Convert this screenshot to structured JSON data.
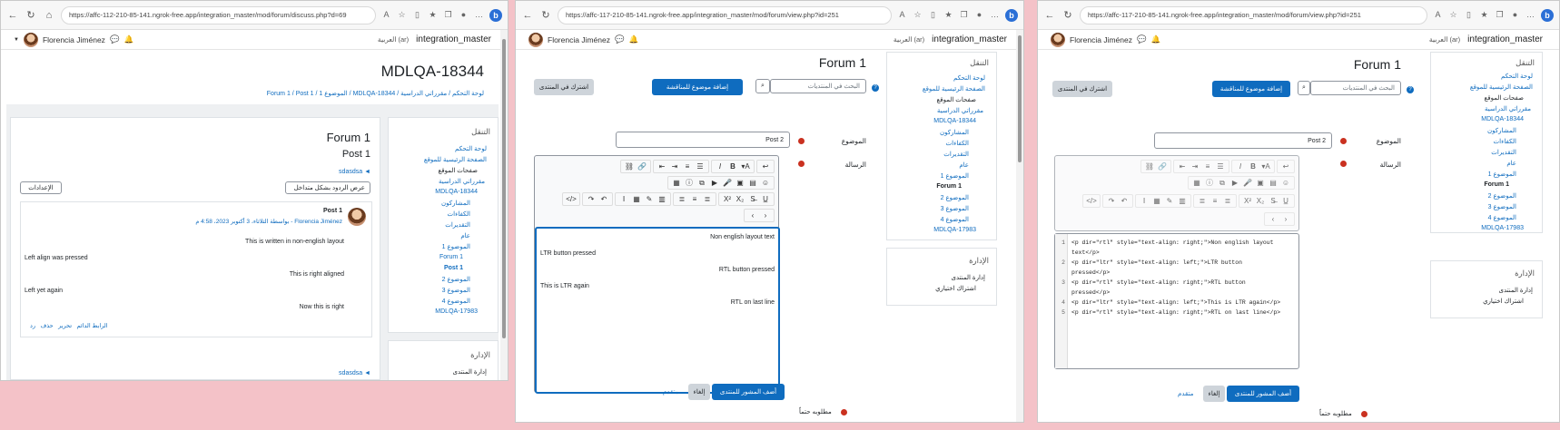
{
  "win1": {
    "url": "https://affc-112-210-85-141.ngrok-free.app/integration_master/mod/forum/discuss.php?d=69",
    "site": "integration_master",
    "lang": "العربية (ar)",
    "user": "Florencia Jiménez",
    "page_title": "MDLQA-18344",
    "breadcrumb": [
      "لوحة التحكم",
      "مقرراتي الدراسية",
      "MDLQA-18344",
      "الموضوع 1",
      "Forum 1",
      "Post 1"
    ],
    "nav_header": "التنقل",
    "nav_items": [
      "لوحة التحكم",
      "الصفحة الرئيسية للموقع",
      "صفحات الموقع",
      "مقرراتي الدراسية",
      "MDLQA-18344",
      "المشاركون",
      "الكفاءات",
      "التقديرات",
      "عام",
      "الموضوع 1",
      "Forum 1",
      "Post 1",
      "الموضوع 2",
      "الموضوع 3",
      "الموضوع 4",
      "MDLQA-17983"
    ],
    "admin_header": "الإدارة",
    "admin_item": "إدارة المنتدى",
    "forum_title": "Forum 1",
    "post_heading": "Post 1",
    "neighbor_link": "sdasdsa ◄",
    "display_mode": "عرض الردود بشكل متداخل",
    "settings": "الإعدادات",
    "post_subject": "Post 1",
    "post_by": "بواسطة الثلاثاء، 3 أكتوبر 2023، 4:58 م - Florencia Jiménez",
    "post_lines": [
      "This is written in non-english layout",
      "Left align was pressed",
      "This is right aligned",
      "Left yet again",
      "Now this is right"
    ],
    "post_actions": [
      "الرابط الدائم",
      "تحرير",
      "حذف",
      "رد"
    ],
    "neighbor_link2": "sdasdsa ◄"
  },
  "win2": {
    "url": "https://affc-117-210-85-141.ngrok-free.app/integration_master/mod/forum/view.php?id=251",
    "site": "integration_master",
    "lang": "العربية (ar)",
    "user": "Florencia Jiménez",
    "forum_title": "Forum 1",
    "search_placeholder": "البحث في المنتديات",
    "add_topic": "إضافة موضوع للمناقشة",
    "subscribe": "اشترك في المنتدى",
    "subject_label": "الموضوع",
    "subject_value": "Post 2",
    "message_label": "الرسالة",
    "editor_lines": [
      "Non english layout text",
      "LTR button pressed",
      "RTL button pressed",
      "This is LTR again",
      "RTL on last line"
    ],
    "post_btn": "أضف المشور للمنتدى",
    "cancel_btn": "إلغاء",
    "advanced": "متقدم",
    "required": "مطلوبه حتماً",
    "nav_header": "التنقل",
    "nav_items": [
      "لوحة التحكم",
      "الصفحة الرئيسية للموقع",
      "صفحات الموقع",
      "مقرراتي الدراسية",
      "MDLQA-18344",
      "المشاركون",
      "الكفاءات",
      "التقديرات",
      "عام",
      "الموضوع 1",
      "Forum 1",
      "الموضوع 2",
      "الموضوع 3",
      "الموضوع 4",
      "MDLQA-17983"
    ],
    "admin_header": "الإدارة",
    "admin_items": [
      "إدارة المنتدى",
      "اشتراك اختياري"
    ]
  },
  "win3": {
    "url": "https://affc-117-210-85-141.ngrok-free.app/integration_master/mod/forum/view.php?id=251",
    "site": "integration_master",
    "lang": "العربية (ar)",
    "user": "Florencia Jiménez",
    "forum_title": "Forum 1",
    "search_placeholder": "البحث في المنتديات",
    "add_topic": "إضافة موضوع للمناقشة",
    "subscribe": "اشترك في المنتدى",
    "subject_label": "الموضوع",
    "subject_value": "Post 2",
    "message_label": "الرسالة",
    "code_lines": [
      "<p dir=\"rtl\" style=\"text-align: right;\">Non english layout",
      "text</p>",
      "<p dir=\"ltr\" style=\"text-align: left;\">LTR button",
      "pressed</p>",
      "<p dir=\"rtl\" style=\"text-align: right;\">RTL button",
      "pressed</p>",
      "<p dir=\"ltr\" style=\"text-align: left;\">This is LTR again</p>",
      "<p dir=\"rtl\" style=\"text-align: right;\">RTL on last line</p>"
    ],
    "line_numbers": [
      "1",
      "2",
      "3",
      "4",
      "5"
    ],
    "post_btn": "أضف المشور للمنتدى",
    "cancel_btn": "إلغاء",
    "advanced": "متقدم",
    "required": "مطلوبه حتماً",
    "nav_header": "التنقل",
    "nav_items": [
      "لوحة التحكم",
      "الصفحة الرئيسية للموقع",
      "صفحات الموقع",
      "مقرراتي الدراسية",
      "MDLQA-18344",
      "المشاركون",
      "الكفاءات",
      "التقديرات",
      "عام",
      "الموضوع 1",
      "Forum 1",
      "الموضوع 2",
      "الموضوع 3",
      "الموضوع 4",
      "MDLQA-17983"
    ],
    "admin_header": "الإدارة",
    "admin_items": [
      "إدارة المنتدى",
      "اشتراك اختياري"
    ]
  },
  "colors": {
    "primary": "#0f6cbf",
    "required": "#ca3120",
    "background": "#f4c2c8"
  },
  "icons": [
    "back-icon",
    "refresh-icon",
    "read-aloud-icon",
    "favorites-icon",
    "collections-icon",
    "bing-icon",
    "chat-icon",
    "bell-icon",
    "home-icon",
    "search-icon",
    "required-icon"
  ]
}
